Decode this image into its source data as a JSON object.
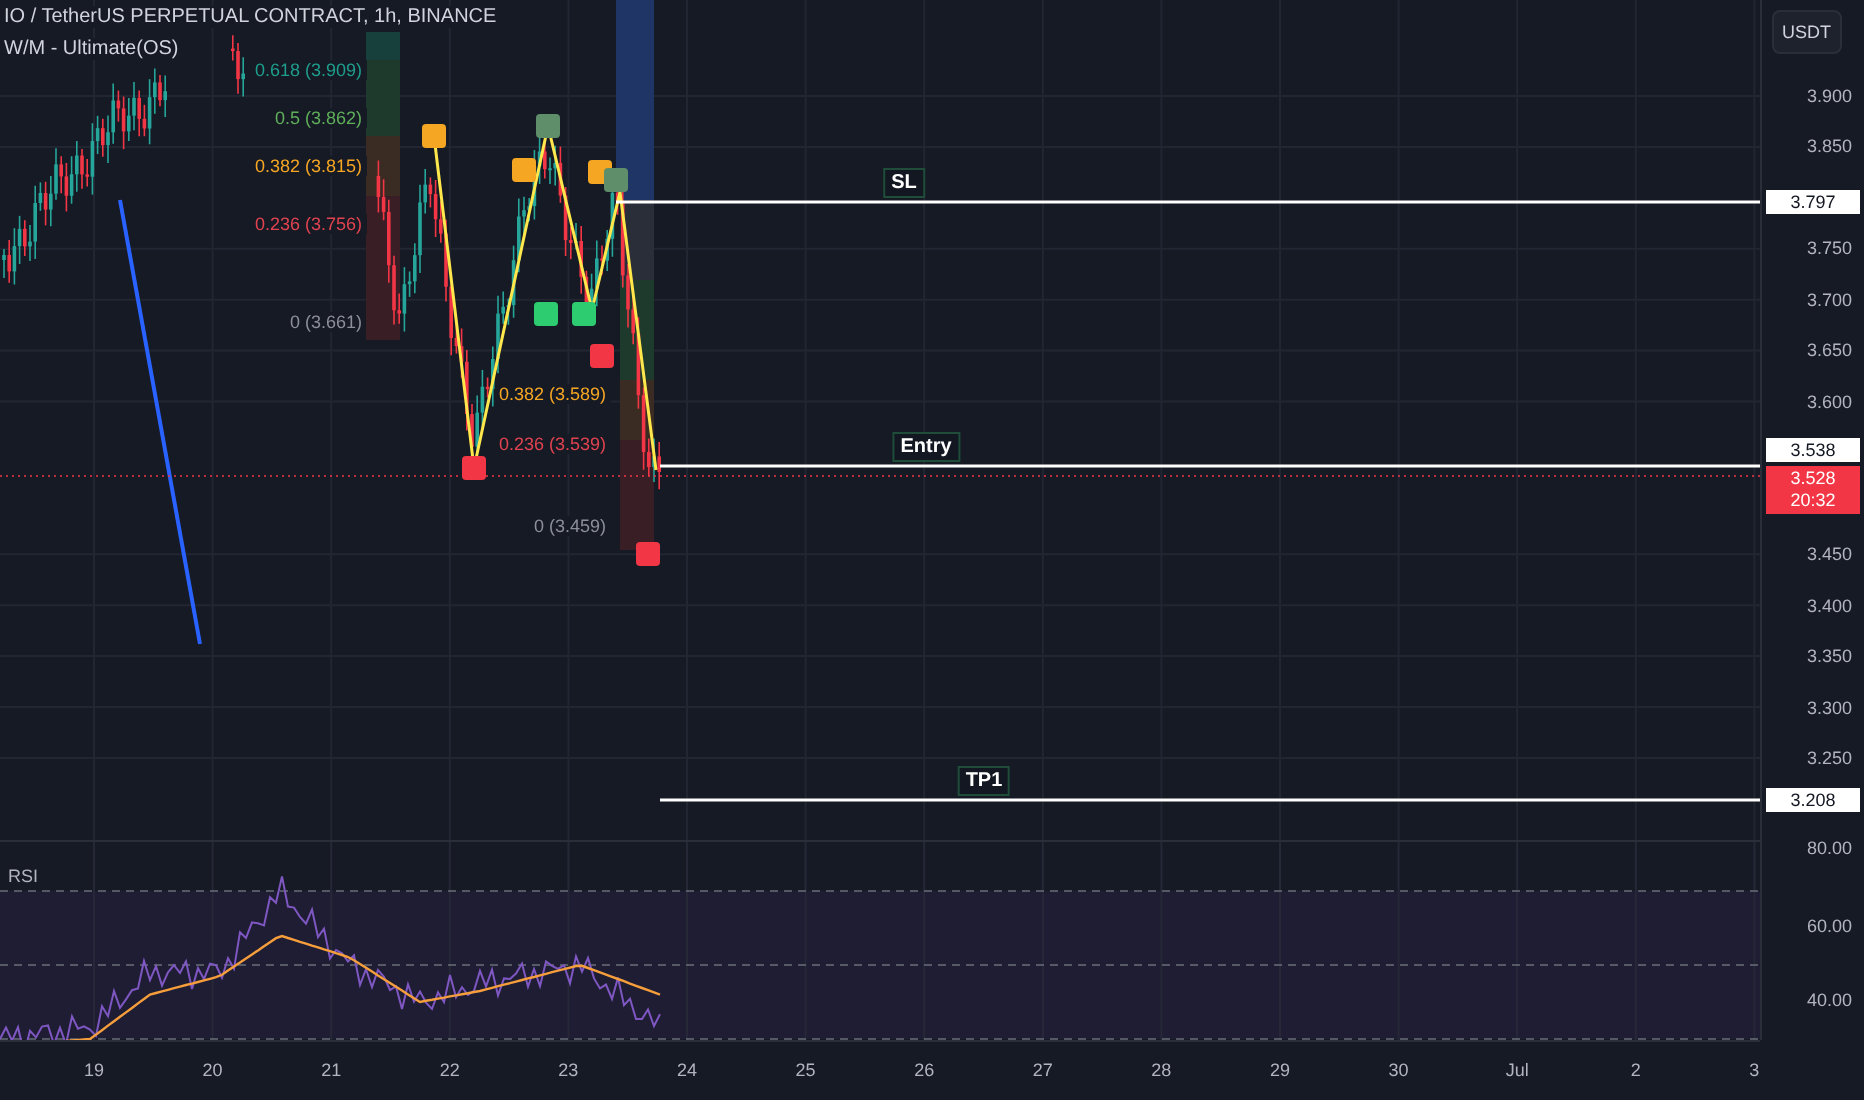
{
  "legend": {
    "symbol": "IO / TetherUS PERPETUAL CONTRACT, 1h, BINANCE",
    "indicator": "W/M - Ultimate(OS)"
  },
  "fib_levels": [
    {
      "label": "0.618 (3.909)",
      "color": "#1e9e8c"
    },
    {
      "label": "0.5 (3.862)",
      "color": "#5fae5a"
    },
    {
      "label": "0.382 (3.815)",
      "color": "#f5a623"
    },
    {
      "label": "0.236 (3.756)",
      "color": "#e0434f"
    },
    {
      "label": "0 (3.661)",
      "color": "#8c8f99"
    },
    {
      "label": "0.382 (3.589)",
      "color": "#f5a623"
    },
    {
      "label": "0.236 (3.539)",
      "color": "#e0434f"
    },
    {
      "label": "0 (3.459)",
      "color": "#8c8f99"
    }
  ],
  "trade_lines": [
    {
      "label": "SL",
      "price": "3.797"
    },
    {
      "label": "Entry",
      "price": "3.538"
    },
    {
      "label": "TP1",
      "price": "3.208"
    }
  ],
  "last_price": {
    "price": "3.528",
    "countdown": "20:32"
  },
  "price_axis": {
    "unit_button": "USDT",
    "ticks": [
      "3.900",
      "3.850",
      "3.750",
      "3.700",
      "3.650",
      "3.600",
      "3.450",
      "3.400",
      "3.350",
      "3.300",
      "3.250"
    ]
  },
  "rsi": {
    "label": "RSI",
    "ticks": [
      "80.00",
      "60.00",
      "40.00"
    ]
  },
  "time_axis": [
    "19",
    "20",
    "21",
    "22",
    "23",
    "24",
    "25",
    "26",
    "27",
    "28",
    "29",
    "30",
    "Jul",
    "2",
    "3"
  ]
}
